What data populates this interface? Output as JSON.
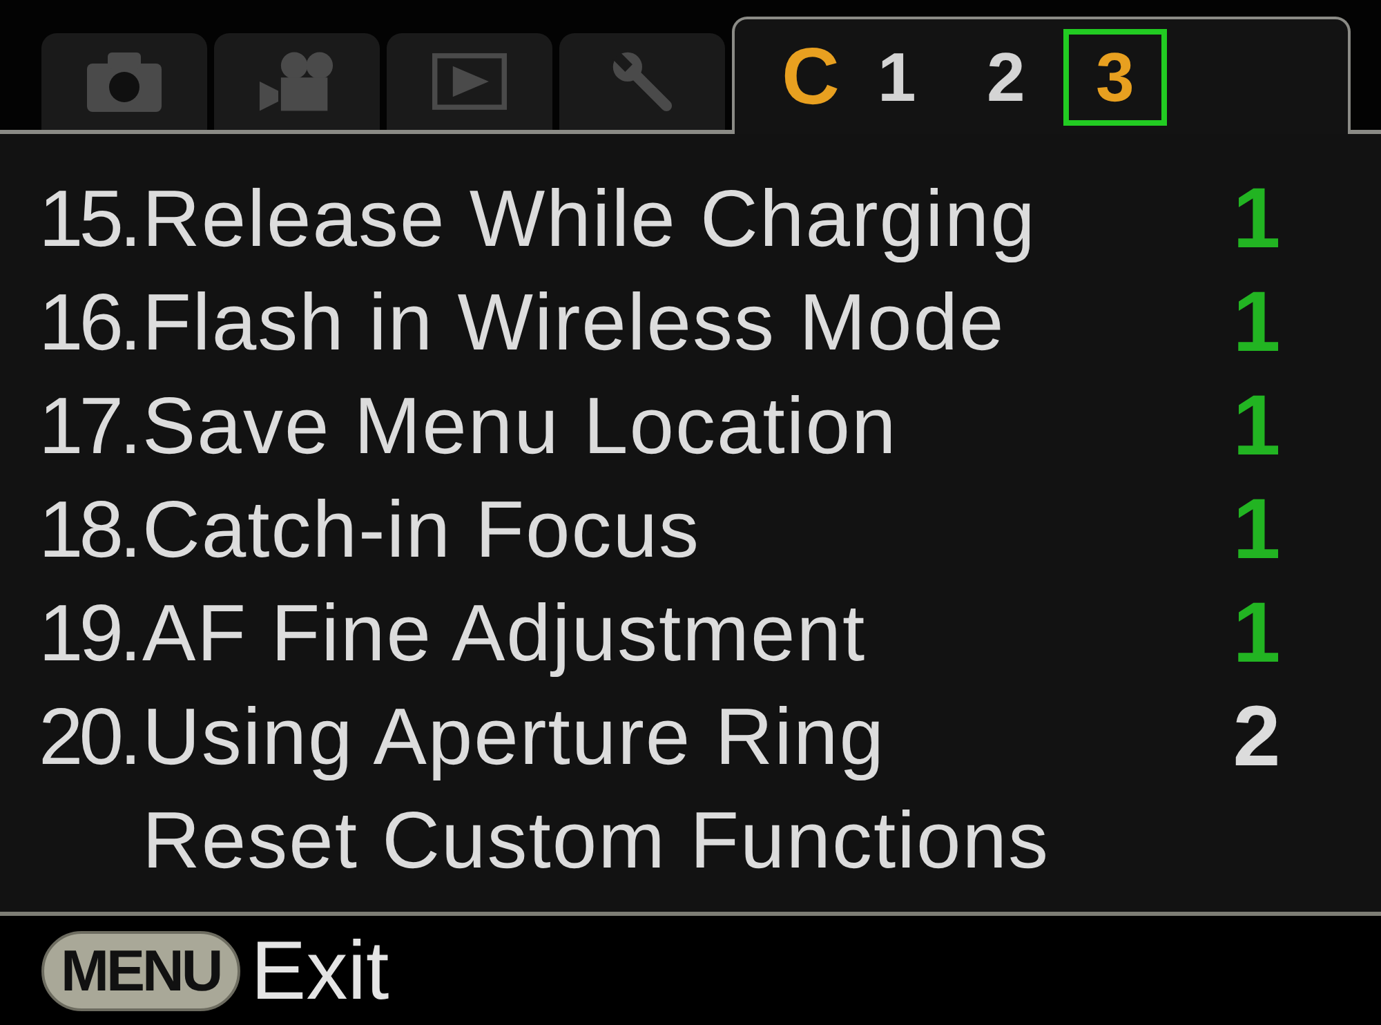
{
  "tabs": [
    {
      "kind": "camera",
      "selected": false
    },
    {
      "kind": "movie",
      "selected": false
    },
    {
      "kind": "playback",
      "selected": false
    },
    {
      "kind": "setup",
      "selected": false
    },
    {
      "kind": "custom",
      "label": "C",
      "selected": true,
      "pages": [
        {
          "label": "1",
          "selected": false
        },
        {
          "label": "2",
          "selected": false
        },
        {
          "label": "3",
          "selected": true
        }
      ]
    }
  ],
  "rows": [
    {
      "number": "15.",
      "label": "Release While Charging",
      "value": "1",
      "color": "#22b422"
    },
    {
      "number": "16.",
      "label": "Flash in Wireless Mode",
      "value": "1",
      "color": "#22b422"
    },
    {
      "number": "17.",
      "label": "Save Menu Location",
      "value": "1",
      "color": "#22b422"
    },
    {
      "number": "18.",
      "label": "Catch-in Focus",
      "value": "1",
      "color": "#22b422"
    },
    {
      "number": "19.",
      "label": "AF Fine Adjustment",
      "value": "1",
      "color": "#22b422"
    },
    {
      "number": "20.",
      "label": "Using Aperture Ring",
      "value": "2",
      "color": "#dcdcdc"
    },
    {
      "label": "Reset Custom Functions"
    }
  ],
  "footer": {
    "button": "MENU",
    "label": "Exit"
  }
}
